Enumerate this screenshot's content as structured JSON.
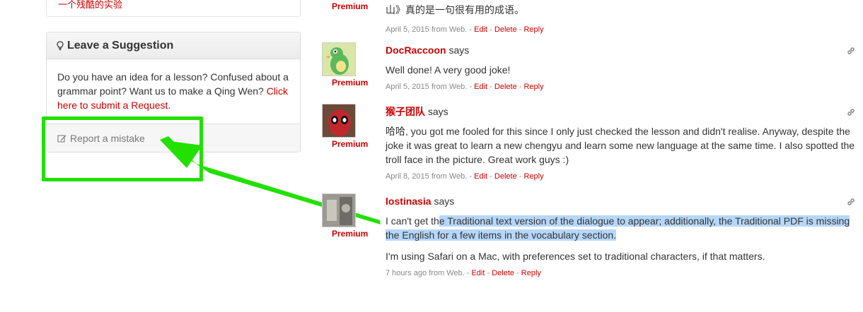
{
  "sidebar": {
    "top_link": "一个残酷的实验",
    "panel": {
      "title": "Leave a Suggestion",
      "body": "Do you have an idea for a lesson? Confused about a grammar point? Want us to make a Qing Wen?",
      "request_link": "Click here to submit a Request",
      "request_suffix": ".",
      "report_label": "Report a mistake"
    }
  },
  "annotation": {
    "highlight_color": "#22e000"
  },
  "comments": {
    "c0": {
      "premium": "Premium",
      "text": "山》真的是一句很有用的成语。",
      "time": "April 5, 2015 from Web.",
      "edit": "Edit",
      "delete": "Delete",
      "reply": "Reply"
    },
    "c1": {
      "author": "DocRaccoon",
      "says": "says",
      "premium": "Premium",
      "text": "Well done! A very good joke!",
      "time": "April 5, 2015 from Web.",
      "edit": "Edit",
      "delete": "Delete",
      "reply": "Reply"
    },
    "c2": {
      "author": "猴子团队",
      "says": "says",
      "premium": "Premium",
      "text": "哈哈, you got me fooled for this since I only just checked the lesson and didn't realise.  Anyway, despite the joke it was great to learn a new chengyu and learn some new language at the same time.  I also spotted the troll face in the picture. Great work guys :)",
      "time": "April 8, 2015 from Web.",
      "edit": "Edit",
      "delete": "Delete",
      "reply": "Reply"
    },
    "c3": {
      "author": "lostinasia",
      "says": "says",
      "premium": "Premium",
      "text_plain": "I can't get th",
      "text_highlight": "e Traditional text version of the dialogue to appear; additionally, the Traditional PDF is missing the English for a few items in the vocabulary section.",
      "text2": "I'm using Safari on a Mac, with preferences set to traditional characters, if that matters.",
      "time": "7 hours ago from Web.",
      "edit": "Edit",
      "delete": "Delete",
      "reply": "Reply"
    }
  }
}
